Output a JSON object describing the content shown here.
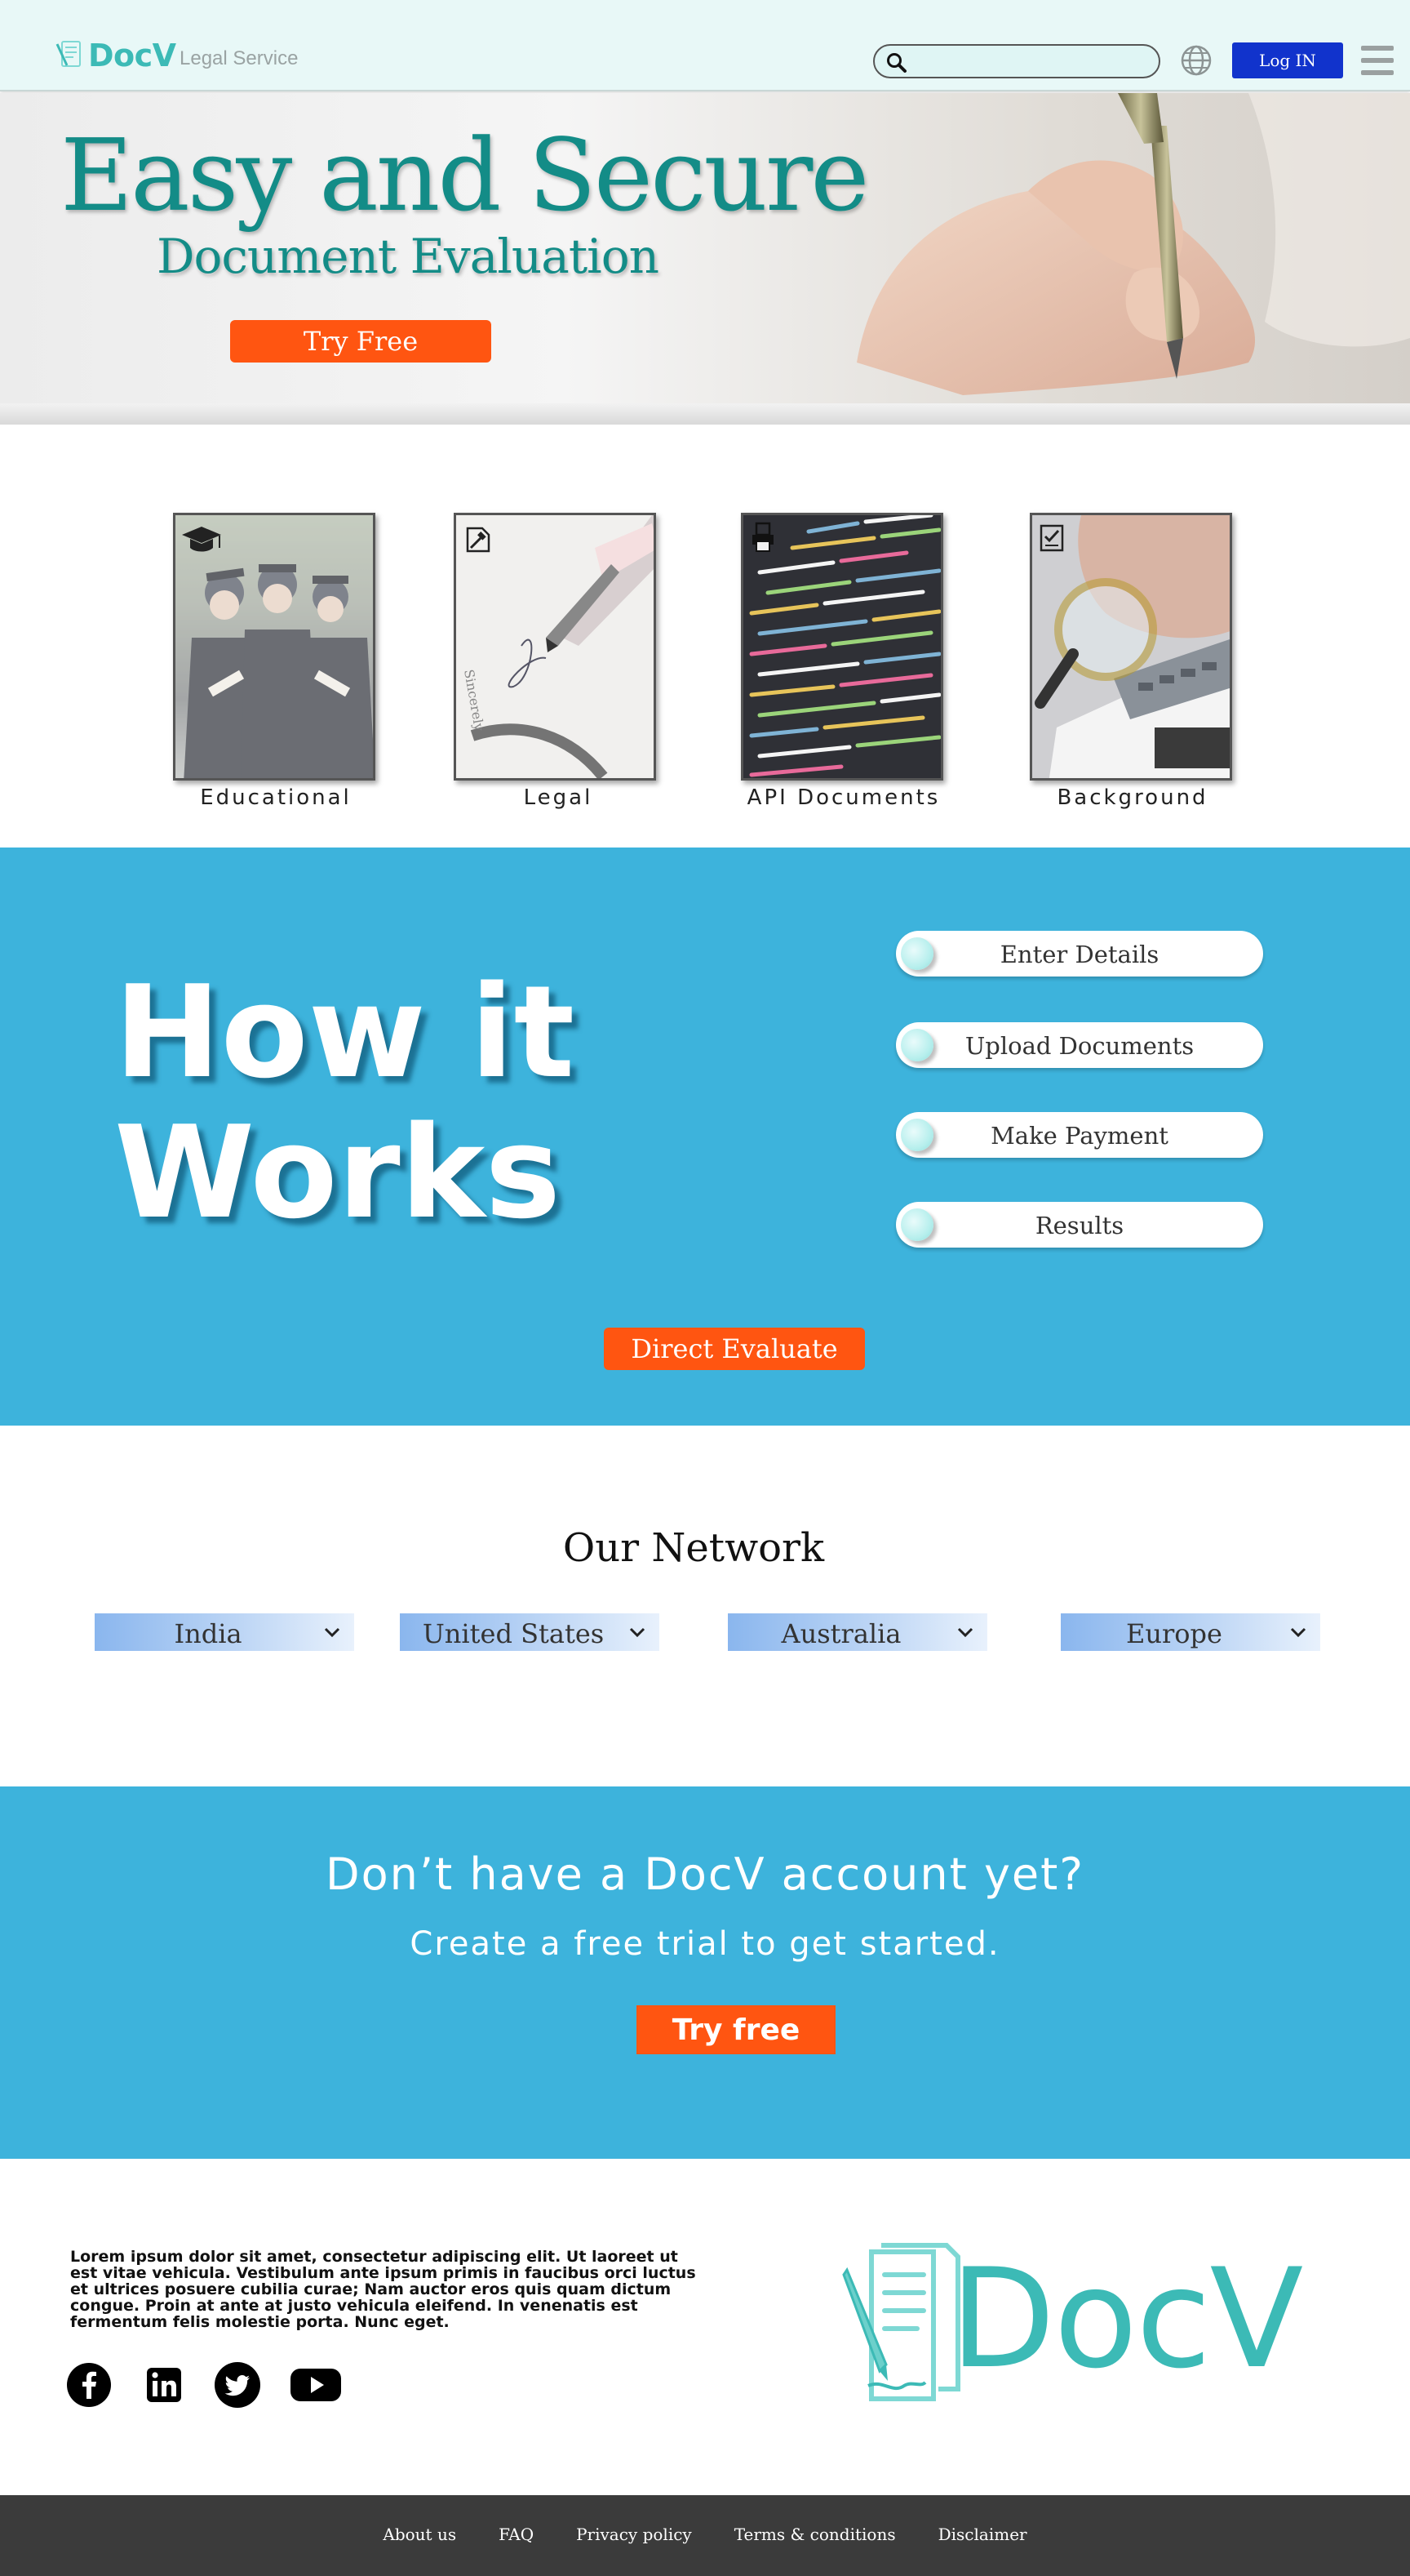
{
  "header": {
    "logo_text": "DocV",
    "tagline": "Legal Service",
    "search_placeholder": "",
    "login_label": "Log IN"
  },
  "hero": {
    "title": "Easy and Secure",
    "subtitle": "Document Evaluation",
    "cta_label": "Try Free"
  },
  "categories": [
    {
      "label": "Educational",
      "icon": "graduation-cap-icon"
    },
    {
      "label": "Legal",
      "icon": "legal-document-icon"
    },
    {
      "label": "API Documents",
      "icon": "printer-document-icon"
    },
    {
      "label": "Background",
      "icon": "checklist-icon"
    }
  ],
  "how_it_works": {
    "title_line1": "How it",
    "title_line2": "Works",
    "steps": [
      "Enter Details",
      "Upload Documents",
      "Make Payment",
      "Results"
    ],
    "cta_label": "Direct Evaluate"
  },
  "network": {
    "title": "Our Network",
    "regions": [
      "India",
      "United States",
      "Australia",
      "Europe"
    ]
  },
  "cta": {
    "heading": "Don’t have a DocV account yet?",
    "subheading": "Create a free trial to get started.",
    "button_label": "Try free"
  },
  "footer": {
    "lorem": "Lorem ipsum dolor sit amet, consectetur adipiscing elit. Ut laoreet ut est vitae vehicula. Vestibulum ante ipsum primis in faucibus orci luctus et ultrices posuere cubilia curae; Nam auctor eros quis quam dictum congue. Proin at ante at justo vehicula eleifend. In venenatis est fermentum felis molestie porta. Nunc eget.",
    "logo_text": "DocV",
    "social": [
      "facebook-icon",
      "linkedin-icon",
      "twitter-icon",
      "youtube-icon"
    ],
    "links": [
      "About us",
      "FAQ",
      "Privacy policy",
      "Terms & conditions",
      "Disclaimer"
    ]
  },
  "colors": {
    "teal": "#3cbab6",
    "hero_teal": "#138c87",
    "section_blue": "#3db3dc",
    "orange": "#ff5511",
    "login_blue": "#1133cc",
    "footer_dark": "#3b3b3b"
  }
}
